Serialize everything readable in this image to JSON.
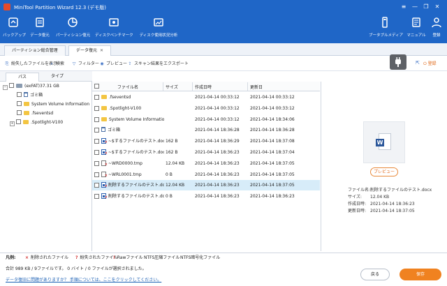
{
  "window": {
    "title": "MiniTool Partition Wizard 12.3 (デモ版)",
    "controls": [
      "≡",
      "—",
      "❐",
      "✕"
    ]
  },
  "ribbon": {
    "left": [
      {
        "id": "backup",
        "label": "バックアップ"
      },
      {
        "id": "data-recovery",
        "label": "データ復元"
      },
      {
        "id": "partition-recovery",
        "label": "パーティション復元"
      },
      {
        "id": "disk-benchmark",
        "label": "ディスクベンチマーク"
      },
      {
        "id": "space-analyzer",
        "label": "ディスク使用状況分析"
      }
    ],
    "right": [
      {
        "id": "bootable-media",
        "label": "ブータブルメディア"
      },
      {
        "id": "manual",
        "label": "マニュアル"
      },
      {
        "id": "register",
        "label": "登録"
      }
    ]
  },
  "tabs": [
    {
      "label": "パーティション総合管理",
      "active": false
    },
    {
      "label": "データ復元",
      "active": true,
      "close": "✕"
    }
  ],
  "actions": [
    {
      "icon": "⎘",
      "label": "紛失したファイルを表示"
    },
    {
      "icon": "⌕",
      "label": "検索"
    },
    {
      "icon": "▽",
      "label": "フィルター"
    },
    {
      "icon": "◉",
      "label": "プレビュー"
    },
    {
      "icon": "⇪",
      "label": "スキャン結果をエクスポート"
    }
  ],
  "login_action": {
    "icon": "⏻",
    "label": "登録"
  },
  "subtabs": [
    "パス",
    "タイプ"
  ],
  "tree": [
    {
      "label": "(exFAT)37.31 GB",
      "level": 0,
      "expander": "−",
      "kind": "drive"
    },
    {
      "label": "ゴミ箱",
      "level": 1,
      "kind": "trash"
    },
    {
      "label": "System Volume Information",
      "level": 1,
      "kind": "folder"
    },
    {
      "label": ".fseventsd",
      "level": 1,
      "kind": "folder"
    },
    {
      "label": ".Spotlight-V100",
      "level": 1,
      "expander": "+",
      "kind": "folder"
    }
  ],
  "file_columns": {
    "name": "ファイル名",
    "size": "サイズ",
    "created": "作成日時",
    "modified": "更新日"
  },
  "files": [
    {
      "name": ".fseventsd",
      "size": "",
      "created": "2021-04-14 00:33:12",
      "modified": "2021-04-14 00:33:12",
      "icon": "folder",
      "selected": false
    },
    {
      "name": ".Spotlight-V100",
      "size": "",
      "created": "2021-04-14 00:33:12",
      "modified": "2021-04-14 00:33:12",
      "icon": "folder",
      "selected": false
    },
    {
      "name": "System Volume Information",
      "size": "",
      "created": "2021-04-14 00:33:12",
      "modified": "2021-04-14 18:34:06",
      "icon": "folder",
      "selected": false
    },
    {
      "name": "ゴミ箱",
      "size": "",
      "created": "2021-04-14 18:36:28",
      "modified": "2021-04-14 18:36:28",
      "icon": "trash",
      "selected": false
    },
    {
      "name": "~$するファイルのテスト.docx",
      "size": "162 B",
      "created": "2021-04-14 18:36:29",
      "modified": "2021-04-14 18:37:08",
      "icon": "doc",
      "mark": "×",
      "selected": false
    },
    {
      "name": "~$するファイルのテスト.docx",
      "size": "162 B",
      "created": "2021-04-14 18:36:23",
      "modified": "2021-04-14 18:37:04",
      "icon": "doc",
      "mark": "×",
      "selected": false
    },
    {
      "name": "~WRD0000.tmp",
      "size": "12.04 KB",
      "created": "2021-04-14 18:36:23",
      "modified": "2021-04-14 18:37:05",
      "icon": "tmp",
      "mark": "×",
      "selected": false
    },
    {
      "name": "~WRL0001.tmp",
      "size": "0 B",
      "created": "2021-04-14 18:36:23",
      "modified": "2021-04-14 18:37:05",
      "icon": "tmp",
      "mark": "×",
      "selected": false
    },
    {
      "name": "削除するファイルのテスト.docx",
      "size": "12.04 KB",
      "created": "2021-04-14 18:36:23",
      "modified": "2021-04-14 18:37:05",
      "icon": "doc",
      "mark": "×",
      "selected": true
    },
    {
      "name": "削除するファイルのテスト.docx",
      "size": "0 B",
      "created": "2021-04-14 18:36:23",
      "modified": "2021-04-14 18:36:23",
      "icon": "doc",
      "mark": "×",
      "selected": false
    }
  ],
  "preview": {
    "button": "プレビュー",
    "info": [
      {
        "k": "ファイル名:",
        "v": "削除するファイルのテスト.docx"
      },
      {
        "k": "サイズ:",
        "v": "12.04 KB"
      },
      {
        "k": "作成日時:",
        "v": "2021-04-14 18:36:23"
      },
      {
        "k": "更新日時:",
        "v": "2021-04-14 18:37:05"
      }
    ]
  },
  "legend": {
    "title": "凡例:",
    "items": [
      {
        "mark": "×",
        "color": "#d32f2f",
        "label": "削除されたファイル"
      },
      {
        "mark": "?",
        "color": "#d32f2f",
        "label": "紛失されたファイル"
      },
      {
        "mark": "!",
        "color": "#d32f2f",
        "label": "Rawファイル"
      },
      {
        "mark": "",
        "color": "#333333",
        "label": "NTFS圧縮ファイル"
      },
      {
        "mark": "",
        "color": "#333333",
        "label": "NTFS暗号化ファイル"
      }
    ]
  },
  "summary": "合計 989 KB / 9ファイルです。 0 バイト / 0 ファイルが選択されました。",
  "help_link": "データ復旧に問題がありますか？ 手順については、ここをクリックしてください。",
  "buttons": {
    "back": "戻る",
    "save": "保存"
  }
}
